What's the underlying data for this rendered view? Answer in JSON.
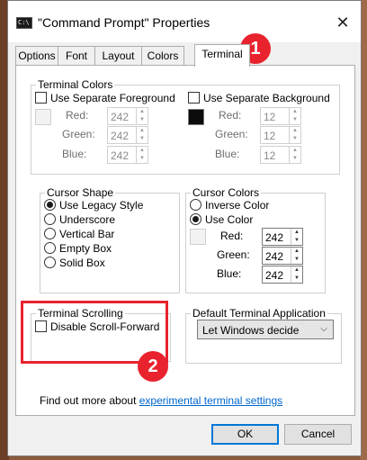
{
  "window": {
    "title": "\"Command Prompt\" Properties",
    "close_glyph": "✕",
    "app_icon_text": "C:\\"
  },
  "tabs": [
    {
      "label": "Options"
    },
    {
      "label": "Font"
    },
    {
      "label": "Layout"
    },
    {
      "label": "Colors"
    },
    {
      "label": "Terminal"
    }
  ],
  "active_tab": "Terminal",
  "terminal_colors": {
    "label": "Terminal Colors",
    "foreground": {
      "checkbox_label": "Use Separate Foreground",
      "checked": false,
      "swatch_color": "#f2f2f2",
      "red_label": "Red:",
      "red": "242",
      "green_label": "Green:",
      "green": "242",
      "blue_label": "Blue:",
      "blue": "242"
    },
    "background": {
      "checkbox_label": "Use Separate Background",
      "checked": false,
      "swatch_color": "#0c0c0c",
      "red_label": "Red:",
      "red": "12",
      "green_label": "Green:",
      "green": "12",
      "blue_label": "Blue:",
      "blue": "12"
    }
  },
  "cursor_shape": {
    "label": "Cursor Shape",
    "options": [
      "Use Legacy Style",
      "Underscore",
      "Vertical Bar",
      "Empty Box",
      "Solid Box"
    ],
    "selected": "Use Legacy Style"
  },
  "cursor_colors": {
    "label": "Cursor Colors",
    "options": [
      "Inverse Color",
      "Use Color"
    ],
    "selected": "Use Color",
    "swatch_color": "#f2f2f2",
    "red_label": "Red:",
    "red": "242",
    "green_label": "Green:",
    "green": "242",
    "blue_label": "Blue:",
    "blue": "242"
  },
  "terminal_scrolling": {
    "label": "Terminal Scrolling",
    "checkbox_label": "Disable Scroll-Forward",
    "checked": false
  },
  "default_terminal": {
    "label": "Default Terminal Application",
    "selected": "Let Windows decide",
    "arrow": "⌵"
  },
  "footer_text": {
    "prefix": "Find out more about ",
    "link": "experimental terminal settings"
  },
  "buttons": {
    "ok": "OK",
    "cancel": "Cancel"
  },
  "annotations": {
    "marker_1": "1",
    "marker_2": "2",
    "color": "#e8232e"
  },
  "spin_glyphs": {
    "up": "▲",
    "down": "▼"
  }
}
